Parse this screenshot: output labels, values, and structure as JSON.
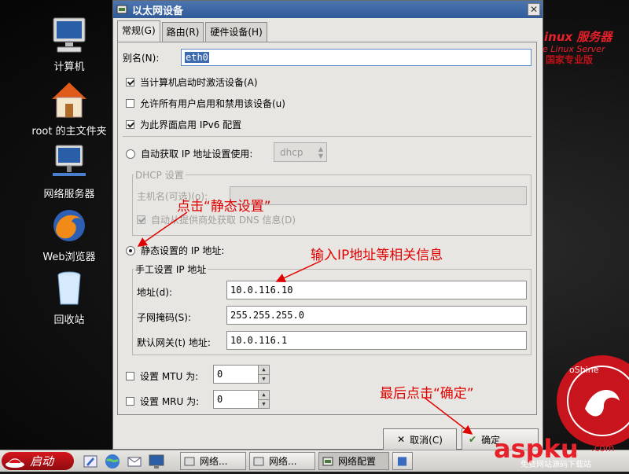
{
  "desktop": {
    "icons": [
      {
        "label": "计算机",
        "icon": "computer-icon"
      },
      {
        "label": "root 的主文件夹",
        "icon": "home-folder-icon"
      },
      {
        "label": "网络服务器",
        "icon": "network-server-icon"
      },
      {
        "label": "Web浏览器",
        "icon": "firefox-icon"
      },
      {
        "label": "回收站",
        "icon": "trash-icon"
      }
    ]
  },
  "window": {
    "title": "以太网设备",
    "tabs": [
      {
        "label": "常规(G)",
        "active": true
      },
      {
        "label": "路由(R)",
        "active": false
      },
      {
        "label": "硬件设备(H)",
        "active": false
      }
    ],
    "alias_label": "别名(N):",
    "alias_value": "eth0",
    "options": [
      {
        "label": "当计算机启动时激活设备(A)",
        "checked": true
      },
      {
        "label": "允许所有用户启用和禁用该设备(u)",
        "checked": false
      },
      {
        "label": "为此界面启用 IPv6 配置",
        "checked": true
      }
    ],
    "auto_ip_label": "自动获取 IP 地址设置使用:",
    "auto_ip_method": "dhcp",
    "dhcp_frame_label": "DHCP 设置",
    "hostname_label": "主机名(可选)(o):",
    "hostname_value": "",
    "dns_label": "自动从提供商处获取 DNS 信息(D)",
    "static_label": "静态设置的 IP 地址:",
    "manual_frame_label": "手工设置 IP 地址",
    "address_label": "地址(d):",
    "address_value": "10.0.116.10",
    "netmask_label": "子网掩码(S):",
    "netmask_value": "255.255.255.0",
    "gateway_label": "默认网关(t) 地址:",
    "gateway_value": "10.0.116.1",
    "mtu_label": "设置 MTU 为:",
    "mtu_value": "0",
    "mru_label": "设置 MRU 为:",
    "mru_value": "0",
    "cancel_label": "取消(C)",
    "ok_label": "确定"
  },
  "annotations": {
    "click_static": "点击“静态设置”",
    "enter_ip": "输入IP地址等相关信息",
    "click_ok": "最后点击“确定”"
  },
  "taskbar": {
    "start_label": "启动",
    "buttons": [
      "网络...",
      "网络...",
      "网络配置"
    ]
  },
  "colors": {
    "annotation": "#e00000",
    "titlebar": "#2f5b9a",
    "start_button": "#d4161c"
  }
}
